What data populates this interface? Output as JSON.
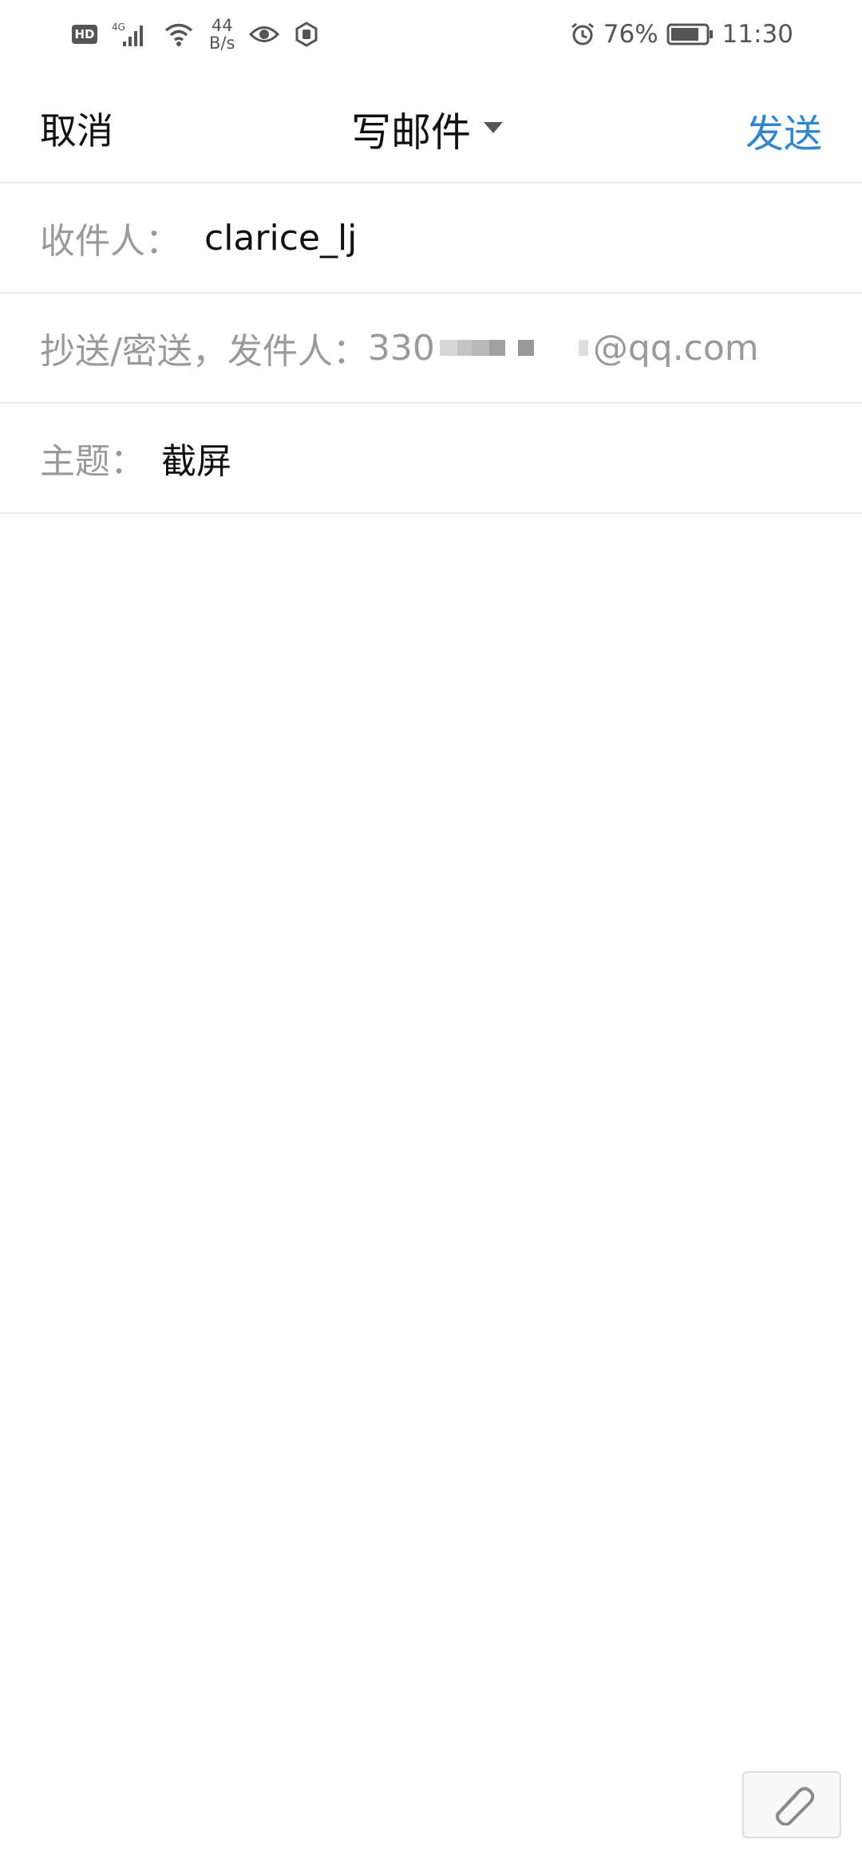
{
  "status_bar": {
    "hd": "HD",
    "network": "4G",
    "net_speed_value": "44",
    "net_speed_unit": "B/s",
    "battery": "76%",
    "time": "11:30"
  },
  "header": {
    "cancel_label": "取消",
    "title": "写邮件",
    "send_label": "发送"
  },
  "fields": {
    "to_label": "收件人：",
    "to_value": "clarice_lj",
    "cc_label": "抄送/密送，发件人：",
    "sender_prefix": "330",
    "sender_suffix": "@qq.com",
    "subject_label": "主题：",
    "subject_value": "截屏"
  },
  "colors": {
    "accent": "#2f86cc",
    "label_gray": "#9a9a9a",
    "divider": "#ececec"
  },
  "icons": {
    "attachment": "paperclip-icon",
    "title_dropdown": "caret-down-icon"
  }
}
